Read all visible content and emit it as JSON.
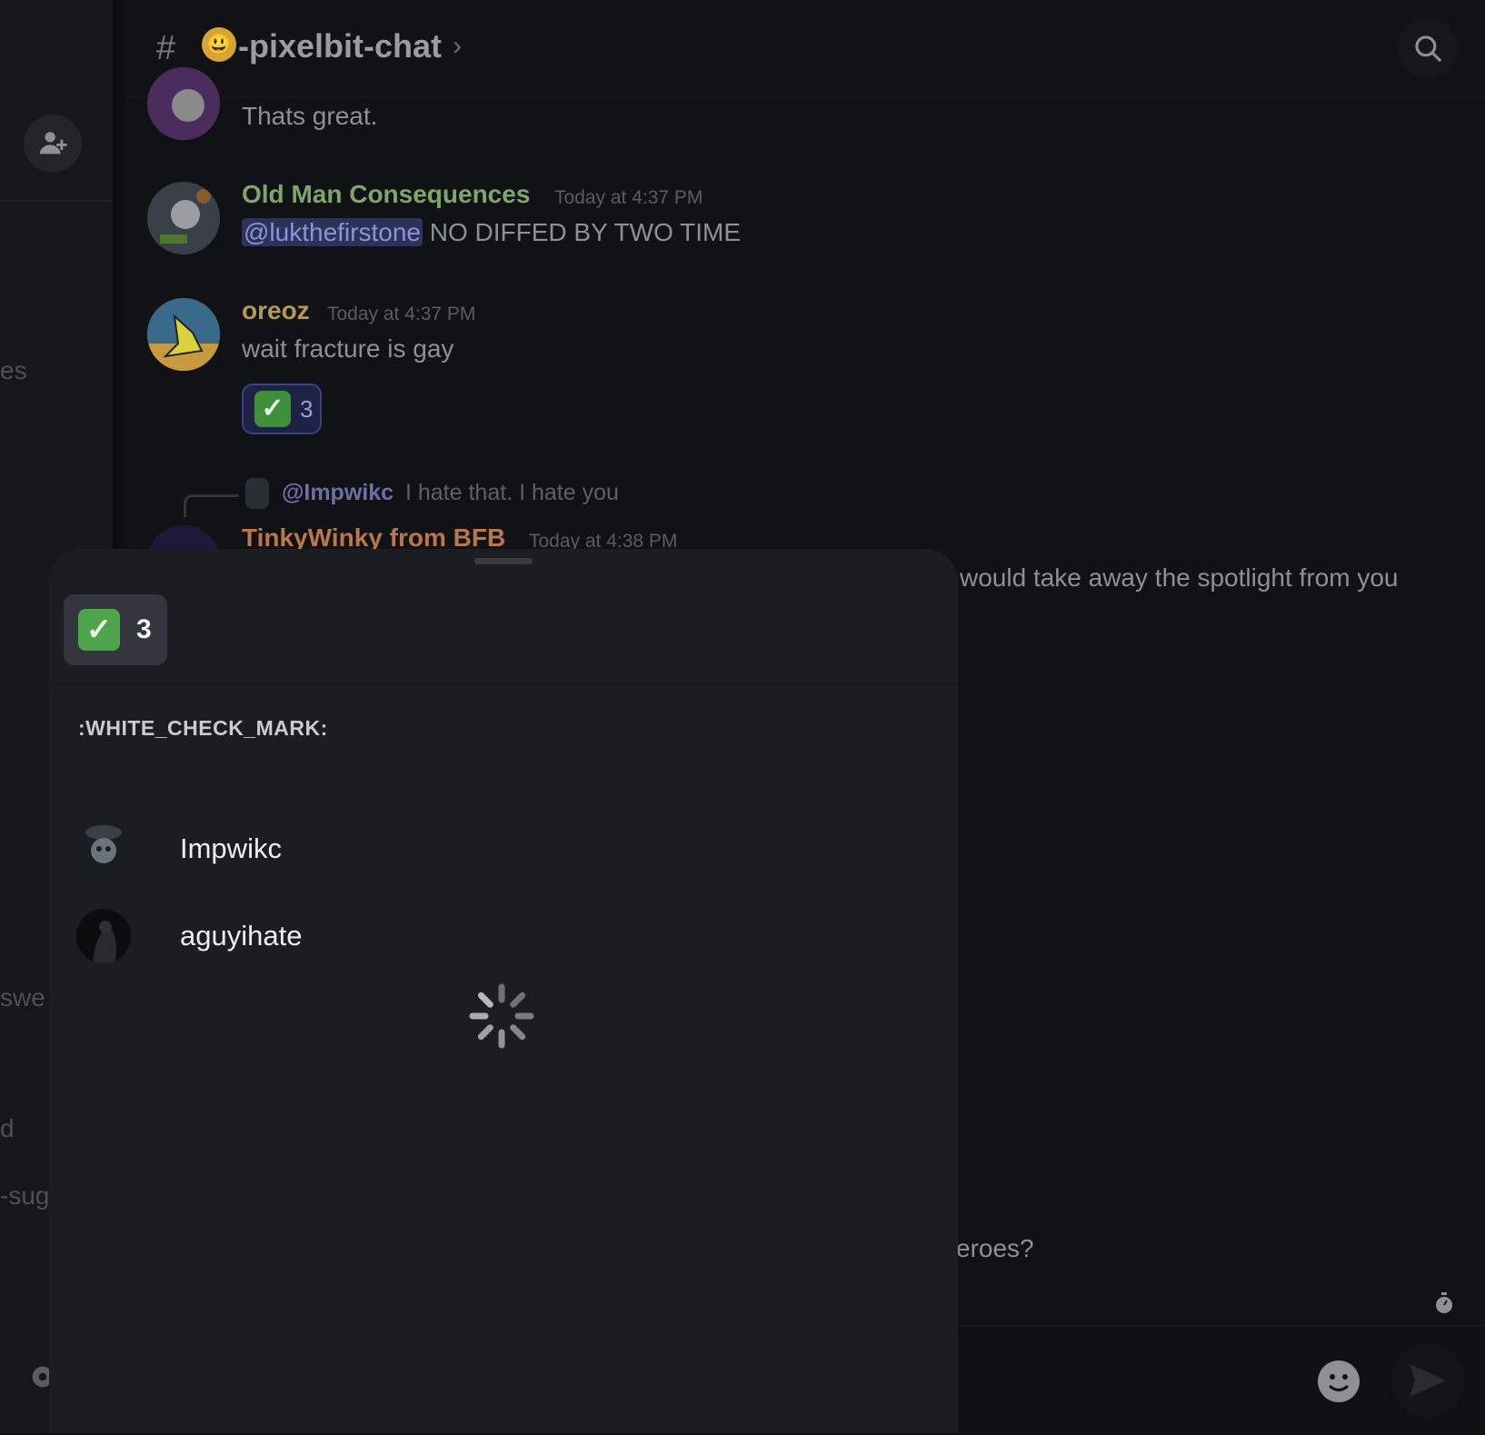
{
  "header": {
    "channel_emoji": "😃",
    "channel_name": "-pixelbit-chat",
    "chevron": "›"
  },
  "sidebar": {
    "fragments": [
      "es",
      "swe",
      "d",
      "-sug"
    ]
  },
  "messages": [
    {
      "text": "Thats great."
    },
    {
      "username": "Old Man Consequences",
      "username_color": "#7fa56a",
      "timestamp": "Today at 4:37 PM",
      "mention": "@lukthefirstone",
      "text": "NO DIFFED BY TWO TIME"
    },
    {
      "username": "oreoz",
      "username_color": "#b39a54",
      "timestamp": "Today at 4:37 PM",
      "text": "wait fracture is gay",
      "reaction": {
        "emoji": "✓",
        "count": "3"
      }
    },
    {
      "reply_to": "@Impwikc",
      "reply_text": "I hate that. I hate you",
      "username": "TinkyWinky from BFB",
      "username_color": "#b8784a",
      "timestamp": "Today at 4:38 PM",
      "text_fragment": "would take away the spotlight from you"
    }
  ],
  "background_fragment": "eroes?",
  "reaction_sheet": {
    "tab_count": "3",
    "emoji_label": ":WHITE_CHECK_MARK:",
    "users": [
      {
        "name": "Impwikc"
      },
      {
        "name": "aguyihate"
      }
    ]
  },
  "icons": [
    "hash-lock-icon",
    "search-icon",
    "add-friend-icon",
    "gear-icon",
    "emoji-icon",
    "send-icon",
    "timer-icon",
    "loading-spinner-icon"
  ]
}
